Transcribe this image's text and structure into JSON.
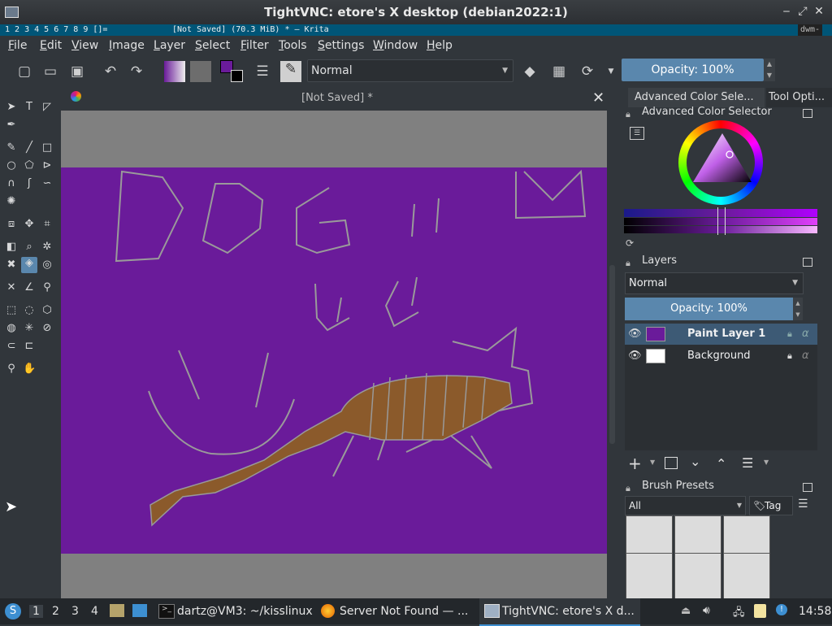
{
  "vnc": {
    "title": "TightVNC: etore's X desktop (debian2022:1)",
    "minimize": "‒",
    "maximize": "⤢",
    "close": "✕"
  },
  "dwm": {
    "tags": "1 2 3 4 5 6 7 8 9 []=",
    "title": "[Not Saved]  (70.3 MiB)  * – Krita",
    "status": "dwm-"
  },
  "menu": [
    "File",
    "Edit",
    "View",
    "Image",
    "Layer",
    "Select",
    "Filter",
    "Tools",
    "Settings",
    "Window",
    "Help"
  ],
  "toolbar": {
    "blend_mode": "Normal",
    "opacity_label": "Opacity: 100%"
  },
  "document": {
    "tab_title": "[Not Saved]  *",
    "close": "✕"
  },
  "drawing": {
    "text": "DOG !!",
    "background_color": "#6a1b9a",
    "dog_body_color": "#8b5a2b"
  },
  "dock": {
    "tabs": [
      "Advanced Color Sele...",
      "Tool Opti..."
    ],
    "color_selector_title": "Advanced Color Selector",
    "layers_title": "Layers",
    "layer_blend": "Normal",
    "layer_opacity": "Opacity:  100%",
    "layers": [
      {
        "name": "Paint Layer 1",
        "selected": true
      },
      {
        "name": "Background",
        "selected": false
      }
    ],
    "brush_presets_title": "Brush Presets",
    "brush_filter": "All",
    "tag_label": "Tag"
  },
  "taskbar": {
    "workspaces": [
      "1",
      "2",
      "3",
      "4"
    ],
    "tasks": [
      "dartz@VM3: ~/kisslinux",
      "Server Not Found — ...",
      "TightVNC: etore's X d..."
    ],
    "clock": "14:58"
  }
}
